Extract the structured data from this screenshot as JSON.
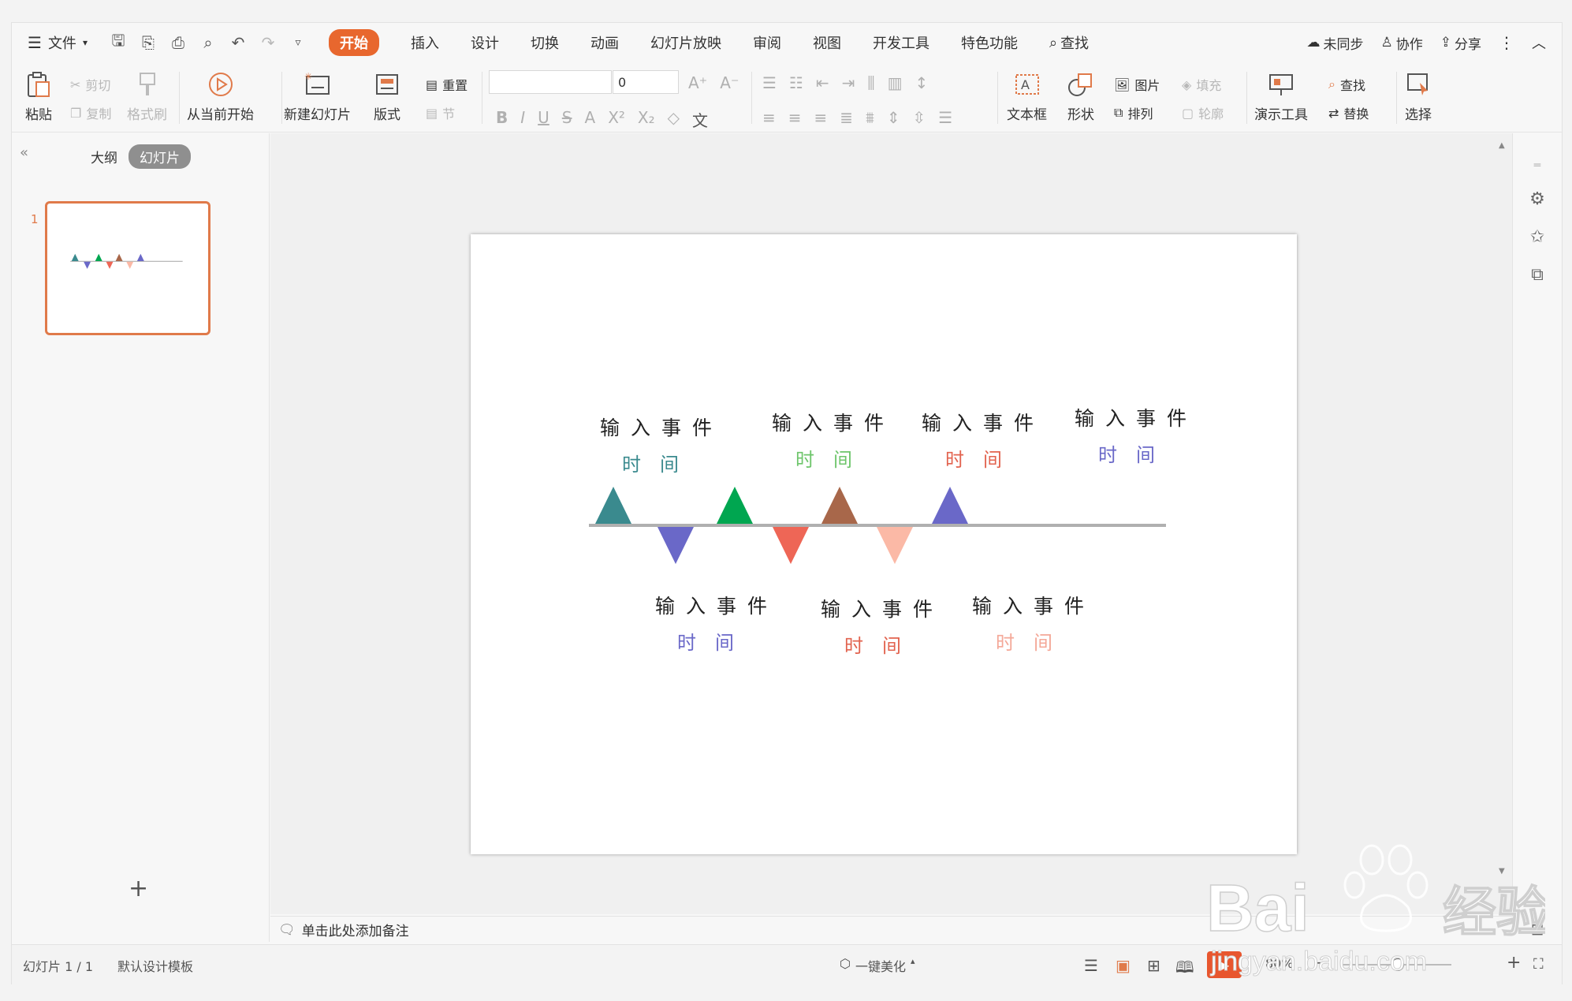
{
  "menu": {
    "file": "文件",
    "tabs": [
      "开始",
      "插入",
      "设计",
      "切换",
      "动画",
      "幻灯片放映",
      "审阅",
      "视图",
      "开发工具",
      "特色功能"
    ],
    "active_tab": "开始",
    "search": "查找",
    "right": [
      "未同步",
      "协作",
      "分享"
    ]
  },
  "ribbon": {
    "paste": "粘贴",
    "cut": "剪切",
    "copy": "复制",
    "format_painter": "格式刷",
    "from_current": "从当前开始",
    "new_slide": "新建幻灯片",
    "layout": "版式",
    "reset": "重置",
    "section": "节",
    "font_size": "0",
    "text_box": "文本框",
    "shape": "形状",
    "picture": "图片",
    "fill": "填充",
    "arrange": "排列",
    "outline": "轮廓",
    "presentation_tools": "演示工具",
    "find": "查找",
    "replace": "替换",
    "select": "选择"
  },
  "left_panel": {
    "outline_tab": "大纲",
    "slides_tab": "幻灯片",
    "slide_number": "1",
    "add": "+"
  },
  "slide": {
    "top_events": [
      {
        "event": "输入事件",
        "time": "时间",
        "color": "#3a8a8e"
      },
      {
        "event": "输入事件",
        "time": "时间",
        "color": "#6ec56b"
      },
      {
        "event": "输入事件",
        "time": "时间",
        "color": "#e2634f"
      },
      {
        "event": "输入事件",
        "time": "时间",
        "color": "#6a68c8"
      }
    ],
    "bottom_events": [
      {
        "event": "输入事件",
        "time": "时间",
        "color": "#6a68c8"
      },
      {
        "event": "输入事件",
        "time": "时间",
        "color": "#e2634f"
      },
      {
        "event": "输入事件",
        "time": "时间",
        "color": "#f4a898"
      }
    ],
    "up_triangle_colors": [
      "#3a8a8e",
      "#00a650",
      "#a8674a",
      "#6a68c8"
    ],
    "down_triangle_colors": [
      "#6a68c8",
      "#ee6656",
      "#fbb9a6"
    ],
    "line_color": "#b0b0b0"
  },
  "notes_placeholder": "单击此处添加备注",
  "status": {
    "slide_count": "幻灯片 1 / 1",
    "template": "默认设计模板",
    "beautify": "一键美化",
    "zoom": "80%"
  },
  "watermark": {
    "text1": "Bai",
    "text2": "经验",
    "url": "jingyan.baidu.com"
  }
}
